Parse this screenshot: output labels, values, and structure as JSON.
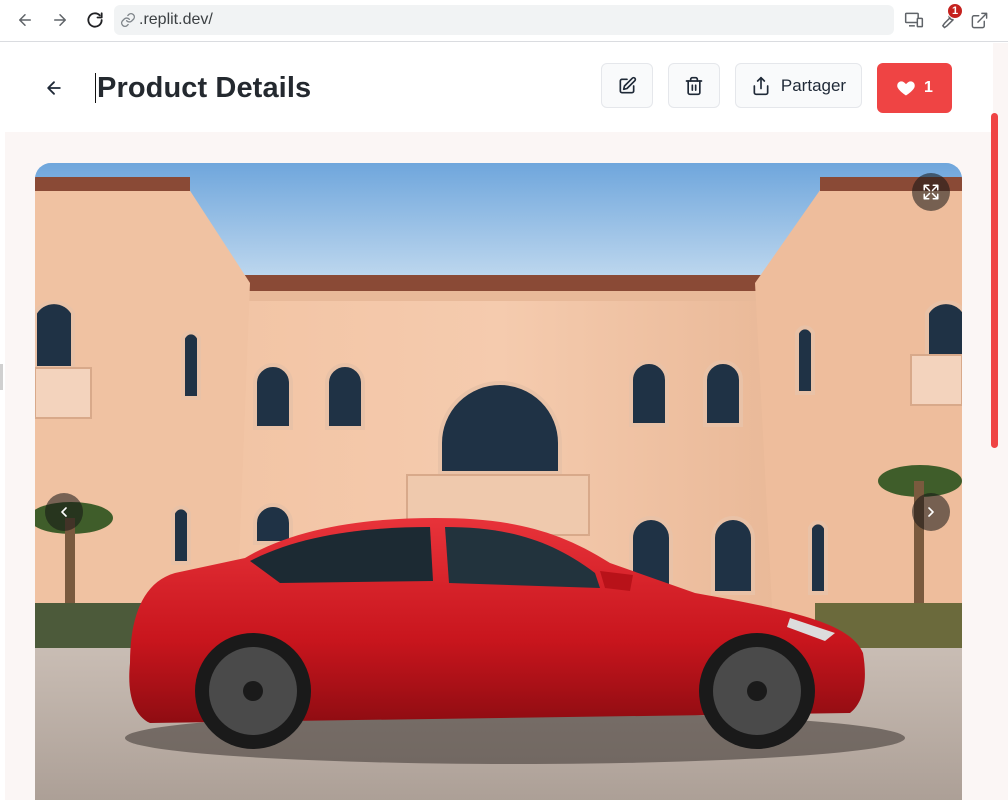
{
  "browser": {
    "url": ".replit.dev/",
    "extension_badge": "1"
  },
  "header": {
    "title": "Product Details",
    "share_label": "Partager",
    "like_count": "1"
  },
  "colors": {
    "accent": "#ef4444",
    "title": "#24292f"
  },
  "gallery": {
    "image_subject": "red car in front of villa",
    "controls": [
      "fullscreen-icon",
      "chevron-left-icon",
      "chevron-right-icon"
    ]
  }
}
